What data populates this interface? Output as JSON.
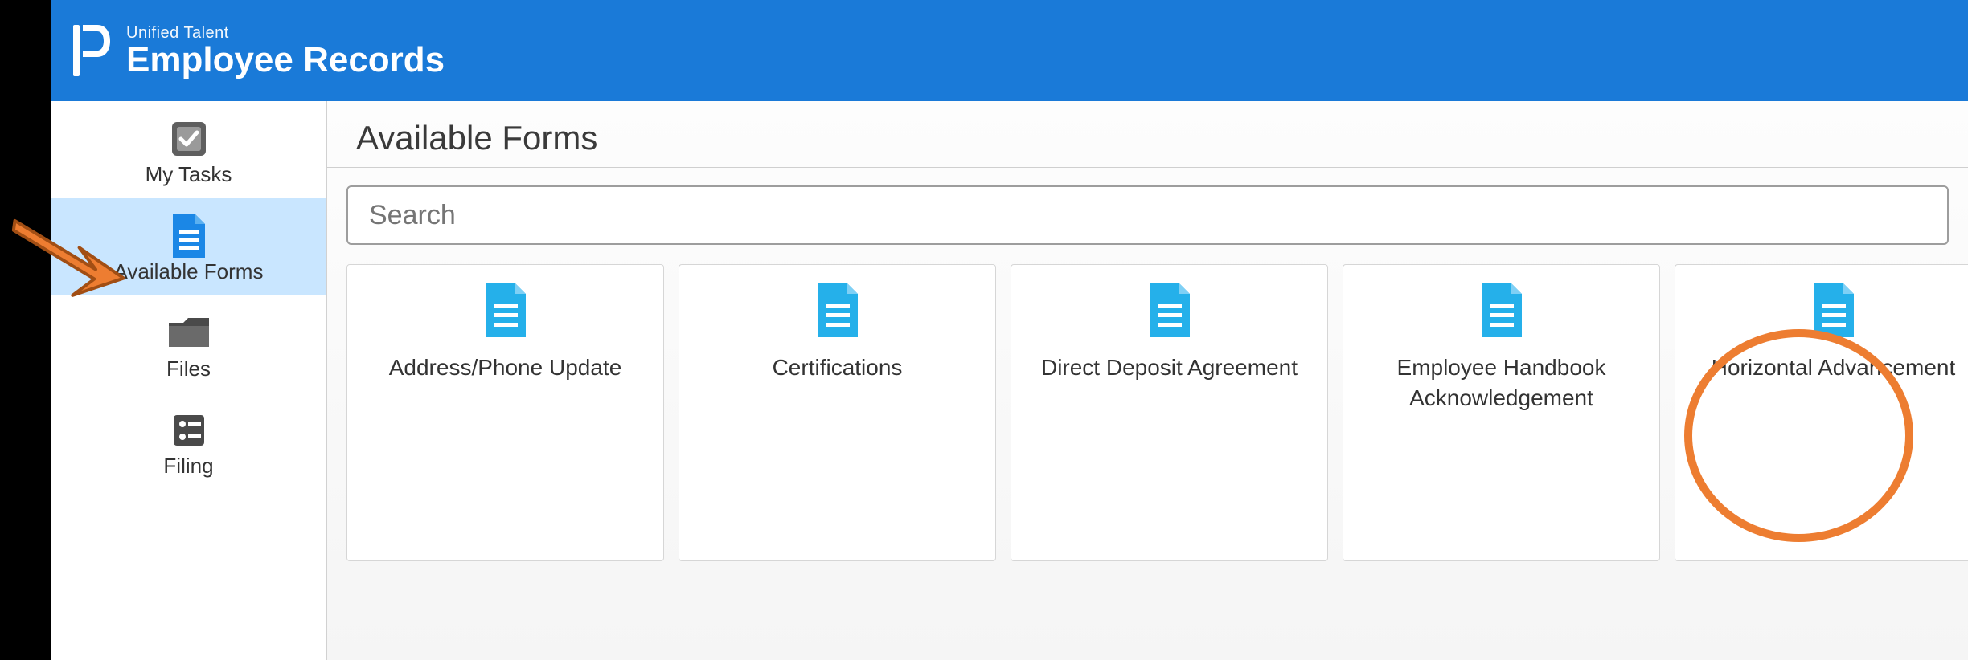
{
  "header": {
    "suite": "Unified Talent",
    "app": "Employee Records"
  },
  "sidebar": {
    "items": [
      {
        "label": "My Tasks",
        "icon": "checkbox-icon",
        "active": false
      },
      {
        "label": "Available Forms",
        "icon": "document-icon",
        "active": true
      },
      {
        "label": "Files",
        "icon": "folder-icon",
        "active": false
      },
      {
        "label": "Filing",
        "icon": "filing-icon",
        "active": false
      }
    ]
  },
  "main": {
    "title": "Available Forms",
    "search_placeholder": "Search",
    "cards": [
      {
        "title": "Address/Phone Update"
      },
      {
        "title": "Certifications"
      },
      {
        "title": "Direct Deposit Agreement"
      },
      {
        "title": "Employee Handbook Acknowledgement"
      },
      {
        "title": "Horizontal Advancement"
      }
    ]
  },
  "annotations": {
    "arrow_color": "#ed7d31",
    "circle_color": "#ed7d31",
    "highlighted_card_index": 4
  }
}
